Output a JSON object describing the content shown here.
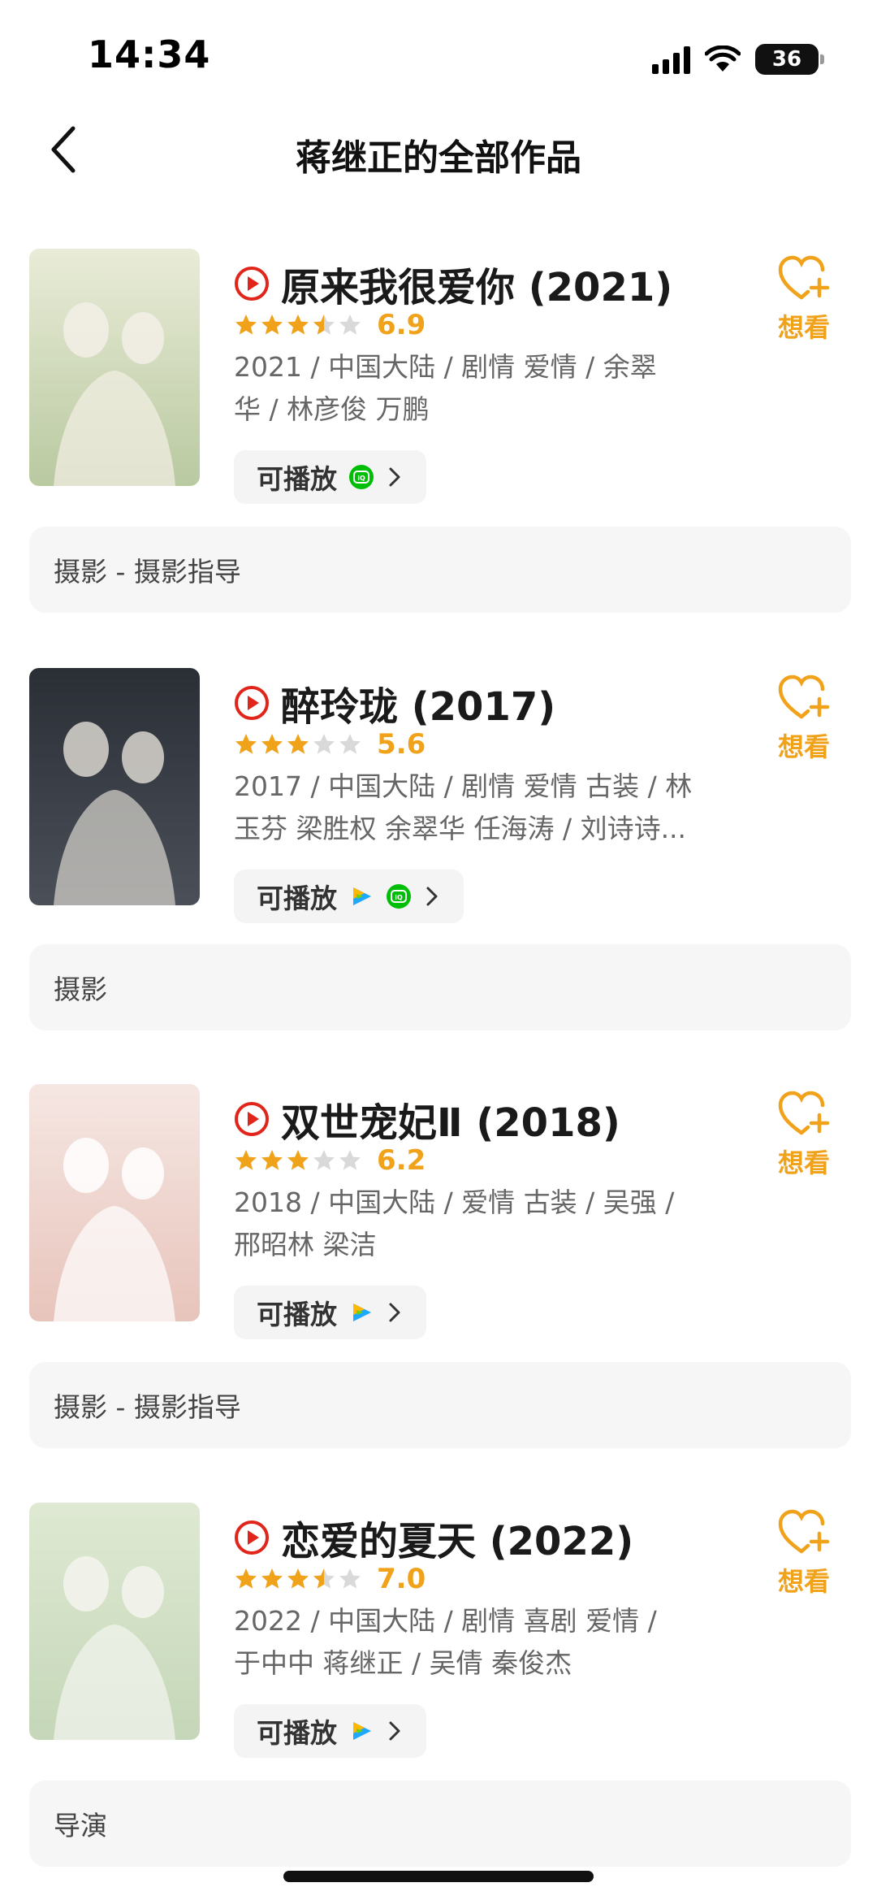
{
  "status_bar": {
    "time": "14:34",
    "battery": "36"
  },
  "header": {
    "title": "蒋继正的全部作品"
  },
  "works": [
    {
      "title": "原来我很爱你 (2021)",
      "rating": 6.9,
      "stars": 3.5,
      "meta_line1": "2021 / 中国大陆 / 剧情 爱情 / 余翠",
      "meta_line2": "华 / 林彦俊 万鹏",
      "play_label": "可播放",
      "platforms": [
        "iqiyi-icon"
      ],
      "want_label": "想看",
      "role": "摄影 - 摄影指导",
      "poster_colors": [
        "#e9ecd8",
        "#b9c9a0",
        "#f3efe6"
      ]
    },
    {
      "title": "醉玲珑 (2017)",
      "rating": 5.6,
      "stars": 3,
      "meta_line1": "2017 / 中国大陆 / 剧情 爱情 古装 / 林",
      "meta_line2": "玉芬 梁胜权 余翠华 任海涛 / 刘诗诗...",
      "play_label": "可播放",
      "platforms": [
        "tencent-video-icon",
        "iqiyi-icon"
      ],
      "want_label": "想看",
      "role": "摄影",
      "poster_colors": [
        "#2a2e35",
        "#4b4f58",
        "#d9d6cf"
      ]
    },
    {
      "title": "双世宠妃Ⅱ (2018)",
      "rating": 6.2,
      "stars": 3,
      "meta_line1": "2018 / 中国大陆 / 爱情 古装 / 吴强 /",
      "meta_line2": "邢昭林 梁洁",
      "play_label": "可播放",
      "platforms": [
        "tencent-video-icon"
      ],
      "want_label": "想看",
      "role": "摄影 - 摄影指导",
      "poster_colors": [
        "#f6e7e3",
        "#e7c4bb",
        "#ffffff"
      ]
    },
    {
      "title": "恋爱的夏天 (2022)",
      "rating": 7.0,
      "stars": 3.5,
      "meta_line1": "2022 / 中国大陆 / 剧情 喜剧 爱情 /",
      "meta_line2": "于中中 蒋继正 / 吴倩 秦俊杰",
      "play_label": "可播放",
      "platforms": [
        "tencent-video-icon"
      ],
      "want_label": "想看",
      "role": "导演",
      "poster_colors": [
        "#dfe9d3",
        "#c5d7b8",
        "#f4f5ef"
      ]
    }
  ],
  "colors": {
    "accent": "#f0a21a",
    "play_red": "#e1251b",
    "iqiyi_green": "#00be06"
  }
}
